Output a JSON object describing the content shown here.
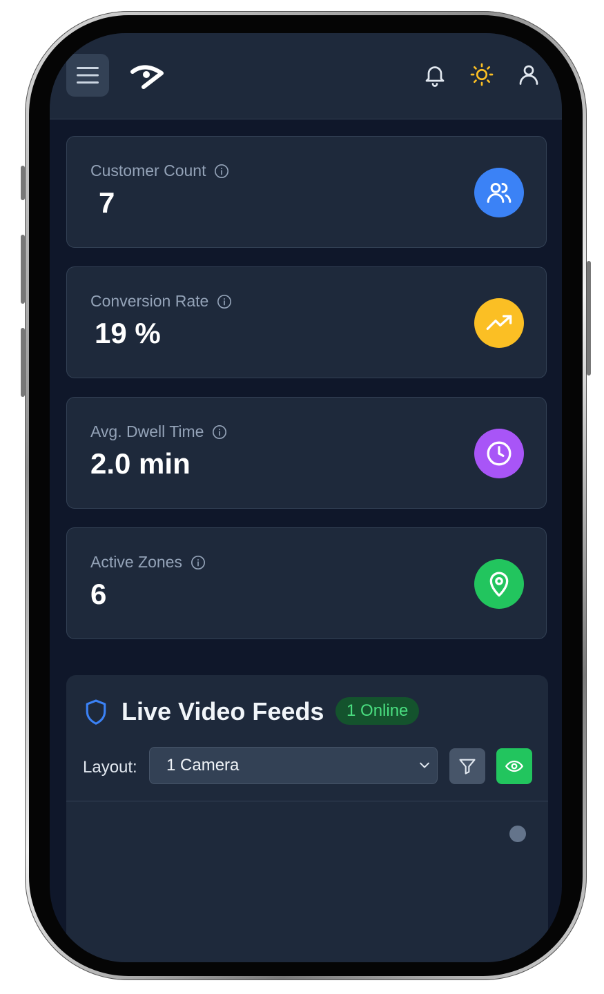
{
  "header": {
    "menu_icon": "hamburger-icon",
    "logo_icon": "eye-logo-icon",
    "notifications_icon": "bell-icon",
    "theme_icon": "sun-icon",
    "profile_icon": "user-icon"
  },
  "stats": [
    {
      "label": "Customer Count",
      "value": "7",
      "icon": "users-icon",
      "color": "#3b82f6"
    },
    {
      "label": "Conversion Rate",
      "value": "19 %",
      "icon": "trending-up-icon",
      "color": "#fbbf24"
    },
    {
      "label": "Avg. Dwell Time",
      "value": "2.0 min",
      "icon": "clock-icon",
      "color": "#a855f7"
    },
    {
      "label": "Active Zones",
      "value": "6",
      "icon": "map-pin-icon",
      "color": "#22c55e"
    }
  ],
  "feeds": {
    "title": "Live Video Feeds",
    "online_count": "1",
    "online_label": "Online",
    "layout_label": "Layout:",
    "layout_value": "1 Camera",
    "filter_icon": "filter-icon",
    "view_icon": "eye-icon"
  },
  "colors": {
    "background": "#0f172a",
    "surface": "#1e293b",
    "border": "#334155",
    "accent_green": "#22c55e",
    "accent_blue": "#3b82f6"
  }
}
